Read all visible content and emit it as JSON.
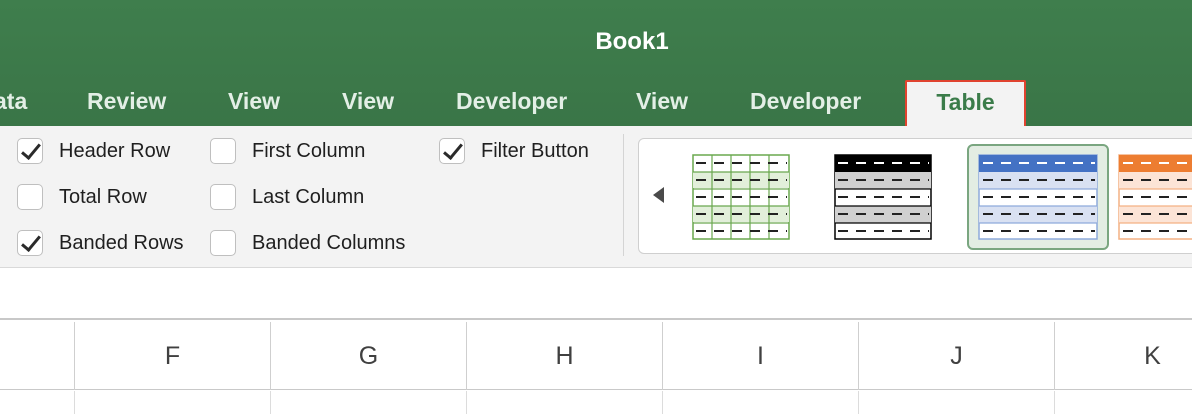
{
  "window": {
    "title": "Book1"
  },
  "tabs": [
    {
      "label": "ata"
    },
    {
      "label": "Review"
    },
    {
      "label": "View"
    },
    {
      "label": "View"
    },
    {
      "label": "Developer"
    },
    {
      "label": "View"
    },
    {
      "label": "Developer"
    },
    {
      "label": "Table",
      "active": true
    }
  ],
  "table_style_options": {
    "header_row": {
      "label": "Header Row",
      "checked": true
    },
    "total_row": {
      "label": "Total Row",
      "checked": false
    },
    "banded_rows": {
      "label": "Banded Rows",
      "checked": true
    },
    "first_column": {
      "label": "First Column",
      "checked": false
    },
    "last_column": {
      "label": "Last Column",
      "checked": false
    },
    "banded_columns": {
      "label": "Banded Columns",
      "checked": false
    },
    "filter_button": {
      "label": "Filter Button",
      "checked": true
    }
  },
  "table_styles_gallery": {
    "styles": [
      {
        "name": "green-light",
        "accent": "#6aa84f",
        "band": "#e2efda"
      },
      {
        "name": "black-medium",
        "accent": "#000000",
        "band": "#d0d0d0"
      },
      {
        "name": "blue-medium",
        "accent": "#4472c4",
        "band": "#d9e1f2",
        "selected": true
      },
      {
        "name": "orange-medium",
        "accent": "#ed7d31",
        "band": "#fce4d6"
      }
    ]
  },
  "columns": [
    "F",
    "G",
    "H",
    "I",
    "J",
    "K"
  ],
  "colors": {
    "brand_green": "#3b7c4a",
    "active_tab_outline": "#e0432f"
  }
}
